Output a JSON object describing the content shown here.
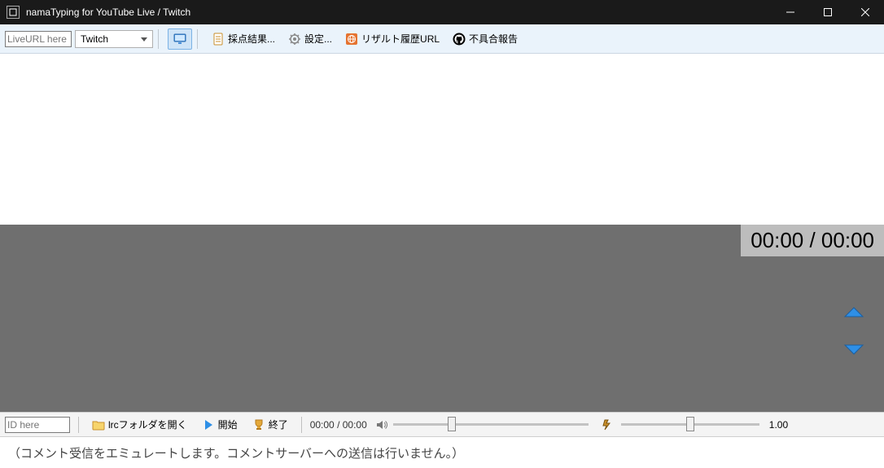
{
  "titlebar": {
    "title": "namaTyping for YouTube Live / Twitch"
  },
  "top_toolbar": {
    "url_placeholder": "LiveURL here",
    "platform_selected": "Twitch",
    "score_label": "採点結果...",
    "settings_label": "設定...",
    "result_url_label": "リザルト履歴URL",
    "bugreport_label": "不具合報告"
  },
  "timer": {
    "display": "00:00 / 00:00"
  },
  "bottom_toolbar": {
    "id_placeholder": "ID here",
    "lrc_label": "lrcフォルダを開く",
    "start_label": "開始",
    "end_label": "終了",
    "time_display": "00:00 / 00:00",
    "speed_value": "1.00"
  },
  "comment": {
    "text": "（コメント受信をエミュレートします。コメントサーバーへの送信は行いません。）"
  }
}
